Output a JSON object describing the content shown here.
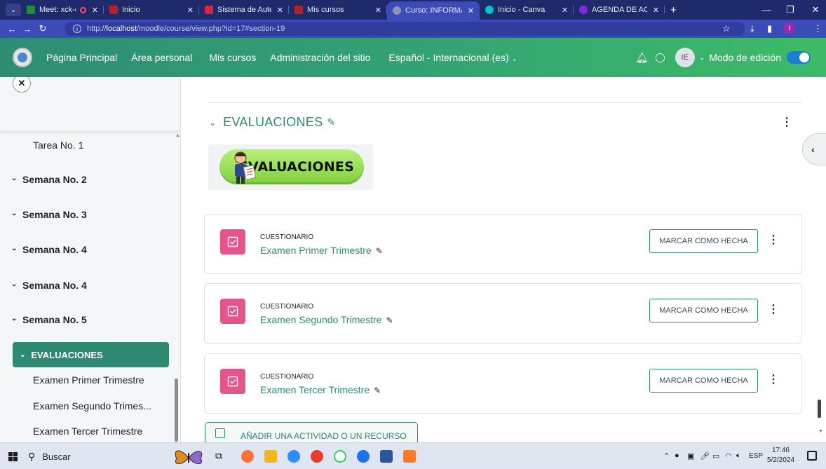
{
  "browser": {
    "tabs": [
      {
        "label": "Meet: xck-q",
        "favicon_color": "#1e8e3e",
        "recording": true,
        "active": false
      },
      {
        "label": "Inicio",
        "favicon_color": "#b22222",
        "recording": false,
        "active": false
      },
      {
        "label": "Sistema de Aute",
        "favicon_color": "#d7263d",
        "recording": false,
        "active": false
      },
      {
        "label": "Mis cursos",
        "favicon_color": "#b22222",
        "recording": false,
        "active": false
      },
      {
        "label": "Curso: INFORMA",
        "favicon_color": "#8e94b8",
        "recording": false,
        "active": true
      },
      {
        "label": "Inicio - Canva",
        "favicon_color": "#00c4cc",
        "recording": false,
        "active": false
      },
      {
        "label": "AGENDA DE AC",
        "favicon_color": "#7d2ae8",
        "recording": false,
        "active": false
      }
    ],
    "url_prefix": "http://",
    "url_host": "localhost",
    "url_path": "/moodle/course/view.php?id=17#section-19",
    "profile_initial": "I"
  },
  "navbar": {
    "links": [
      "Página Principal",
      "Área personal",
      "Mis cursos",
      "Administración del sitio",
      "Español - Internacional (es)"
    ],
    "avatar_initials": "IE",
    "edit_mode_label": "Modo de edición",
    "edit_mode_on": true
  },
  "drawer": {
    "items": [
      {
        "label": "Tarea No. 1",
        "kind": "activity"
      },
      {
        "label": "Semana No. 2",
        "kind": "section"
      },
      {
        "label": "Semana No. 3",
        "kind": "section"
      },
      {
        "label": "Semana No. 4",
        "kind": "section"
      },
      {
        "label": "Semana No. 4",
        "kind": "section"
      },
      {
        "label": "Semana No. 5",
        "kind": "section"
      },
      {
        "label": "EVALUACIONES",
        "kind": "section",
        "active": true
      },
      {
        "label": "Examen Primer Trimestre",
        "kind": "activity"
      },
      {
        "label": "Examen Segundo Trimes...",
        "kind": "activity"
      },
      {
        "label": "Examen Tercer Trimestre",
        "kind": "activity"
      }
    ]
  },
  "section": {
    "title": "EVALUACIONES",
    "banner_text": "EVALUACIONES"
  },
  "activities": [
    {
      "type": "CUESTIONARIO",
      "name": "Examen Primer Trimestre",
      "action": "MARCAR COMO HECHA"
    },
    {
      "type": "CUESTIONARIO",
      "name": "Examen Segundo Trimestre",
      "action": "MARCAR COMO HECHA"
    },
    {
      "type": "CUESTIONARIO",
      "name": "Examen Tercer Trimestre",
      "action": "MARCAR COMO HECHA"
    }
  ],
  "add_activity_label": "AÑADIR UNA ACTIVIDAD O UN RECURSO",
  "taskbar": {
    "search_label": "Buscar",
    "language": "ESP",
    "time": "17:46",
    "date": "5/2/2024"
  },
  "colors": {
    "brand": "#2f8a72",
    "quiz_icon": "#e5558a",
    "toggle": "#1c7cd6"
  }
}
